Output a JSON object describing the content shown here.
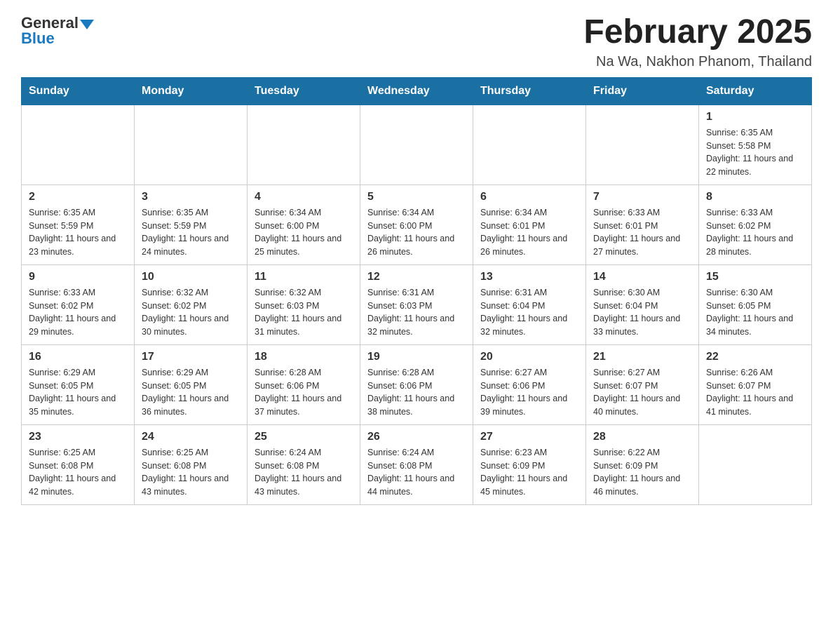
{
  "logo": {
    "general": "General",
    "blue": "Blue"
  },
  "title": "February 2025",
  "subtitle": "Na Wa, Nakhon Phanom, Thailand",
  "days_of_week": [
    "Sunday",
    "Monday",
    "Tuesday",
    "Wednesday",
    "Thursday",
    "Friday",
    "Saturday"
  ],
  "weeks": [
    [
      {
        "day": "",
        "sunrise": "",
        "sunset": "",
        "daylight": ""
      },
      {
        "day": "",
        "sunrise": "",
        "sunset": "",
        "daylight": ""
      },
      {
        "day": "",
        "sunrise": "",
        "sunset": "",
        "daylight": ""
      },
      {
        "day": "",
        "sunrise": "",
        "sunset": "",
        "daylight": ""
      },
      {
        "day": "",
        "sunrise": "",
        "sunset": "",
        "daylight": ""
      },
      {
        "day": "",
        "sunrise": "",
        "sunset": "",
        "daylight": ""
      },
      {
        "day": "1",
        "sunrise": "Sunrise: 6:35 AM",
        "sunset": "Sunset: 5:58 PM",
        "daylight": "Daylight: 11 hours and 22 minutes."
      }
    ],
    [
      {
        "day": "2",
        "sunrise": "Sunrise: 6:35 AM",
        "sunset": "Sunset: 5:59 PM",
        "daylight": "Daylight: 11 hours and 23 minutes."
      },
      {
        "day": "3",
        "sunrise": "Sunrise: 6:35 AM",
        "sunset": "Sunset: 5:59 PM",
        "daylight": "Daylight: 11 hours and 24 minutes."
      },
      {
        "day": "4",
        "sunrise": "Sunrise: 6:34 AM",
        "sunset": "Sunset: 6:00 PM",
        "daylight": "Daylight: 11 hours and 25 minutes."
      },
      {
        "day": "5",
        "sunrise": "Sunrise: 6:34 AM",
        "sunset": "Sunset: 6:00 PM",
        "daylight": "Daylight: 11 hours and 26 minutes."
      },
      {
        "day": "6",
        "sunrise": "Sunrise: 6:34 AM",
        "sunset": "Sunset: 6:01 PM",
        "daylight": "Daylight: 11 hours and 26 minutes."
      },
      {
        "day": "7",
        "sunrise": "Sunrise: 6:33 AM",
        "sunset": "Sunset: 6:01 PM",
        "daylight": "Daylight: 11 hours and 27 minutes."
      },
      {
        "day": "8",
        "sunrise": "Sunrise: 6:33 AM",
        "sunset": "Sunset: 6:02 PM",
        "daylight": "Daylight: 11 hours and 28 minutes."
      }
    ],
    [
      {
        "day": "9",
        "sunrise": "Sunrise: 6:33 AM",
        "sunset": "Sunset: 6:02 PM",
        "daylight": "Daylight: 11 hours and 29 minutes."
      },
      {
        "day": "10",
        "sunrise": "Sunrise: 6:32 AM",
        "sunset": "Sunset: 6:02 PM",
        "daylight": "Daylight: 11 hours and 30 minutes."
      },
      {
        "day": "11",
        "sunrise": "Sunrise: 6:32 AM",
        "sunset": "Sunset: 6:03 PM",
        "daylight": "Daylight: 11 hours and 31 minutes."
      },
      {
        "day": "12",
        "sunrise": "Sunrise: 6:31 AM",
        "sunset": "Sunset: 6:03 PM",
        "daylight": "Daylight: 11 hours and 32 minutes."
      },
      {
        "day": "13",
        "sunrise": "Sunrise: 6:31 AM",
        "sunset": "Sunset: 6:04 PM",
        "daylight": "Daylight: 11 hours and 32 minutes."
      },
      {
        "day": "14",
        "sunrise": "Sunrise: 6:30 AM",
        "sunset": "Sunset: 6:04 PM",
        "daylight": "Daylight: 11 hours and 33 minutes."
      },
      {
        "day": "15",
        "sunrise": "Sunrise: 6:30 AM",
        "sunset": "Sunset: 6:05 PM",
        "daylight": "Daylight: 11 hours and 34 minutes."
      }
    ],
    [
      {
        "day": "16",
        "sunrise": "Sunrise: 6:29 AM",
        "sunset": "Sunset: 6:05 PM",
        "daylight": "Daylight: 11 hours and 35 minutes."
      },
      {
        "day": "17",
        "sunrise": "Sunrise: 6:29 AM",
        "sunset": "Sunset: 6:05 PM",
        "daylight": "Daylight: 11 hours and 36 minutes."
      },
      {
        "day": "18",
        "sunrise": "Sunrise: 6:28 AM",
        "sunset": "Sunset: 6:06 PM",
        "daylight": "Daylight: 11 hours and 37 minutes."
      },
      {
        "day": "19",
        "sunrise": "Sunrise: 6:28 AM",
        "sunset": "Sunset: 6:06 PM",
        "daylight": "Daylight: 11 hours and 38 minutes."
      },
      {
        "day": "20",
        "sunrise": "Sunrise: 6:27 AM",
        "sunset": "Sunset: 6:06 PM",
        "daylight": "Daylight: 11 hours and 39 minutes."
      },
      {
        "day": "21",
        "sunrise": "Sunrise: 6:27 AM",
        "sunset": "Sunset: 6:07 PM",
        "daylight": "Daylight: 11 hours and 40 minutes."
      },
      {
        "day": "22",
        "sunrise": "Sunrise: 6:26 AM",
        "sunset": "Sunset: 6:07 PM",
        "daylight": "Daylight: 11 hours and 41 minutes."
      }
    ],
    [
      {
        "day": "23",
        "sunrise": "Sunrise: 6:25 AM",
        "sunset": "Sunset: 6:08 PM",
        "daylight": "Daylight: 11 hours and 42 minutes."
      },
      {
        "day": "24",
        "sunrise": "Sunrise: 6:25 AM",
        "sunset": "Sunset: 6:08 PM",
        "daylight": "Daylight: 11 hours and 43 minutes."
      },
      {
        "day": "25",
        "sunrise": "Sunrise: 6:24 AM",
        "sunset": "Sunset: 6:08 PM",
        "daylight": "Daylight: 11 hours and 43 minutes."
      },
      {
        "day": "26",
        "sunrise": "Sunrise: 6:24 AM",
        "sunset": "Sunset: 6:08 PM",
        "daylight": "Daylight: 11 hours and 44 minutes."
      },
      {
        "day": "27",
        "sunrise": "Sunrise: 6:23 AM",
        "sunset": "Sunset: 6:09 PM",
        "daylight": "Daylight: 11 hours and 45 minutes."
      },
      {
        "day": "28",
        "sunrise": "Sunrise: 6:22 AM",
        "sunset": "Sunset: 6:09 PM",
        "daylight": "Daylight: 11 hours and 46 minutes."
      },
      {
        "day": "",
        "sunrise": "",
        "sunset": "",
        "daylight": ""
      }
    ]
  ]
}
